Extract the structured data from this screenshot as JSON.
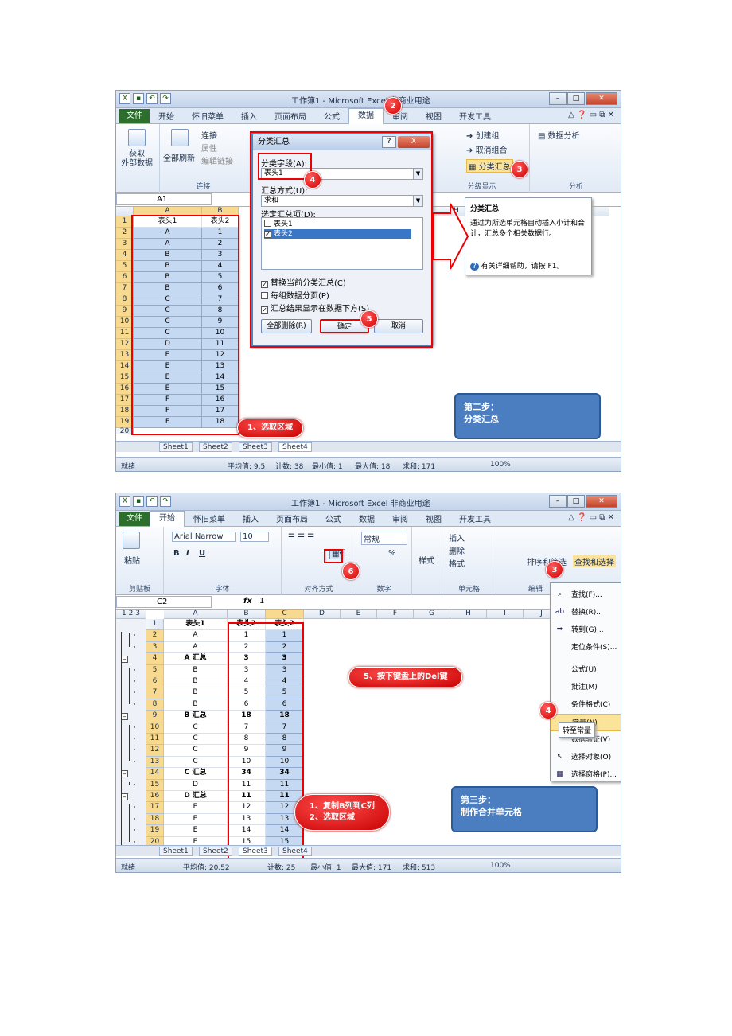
{
  "common": {
    "window_title": "工作簿1 - Microsoft Excel 非商业用途",
    "file_tab": "文件",
    "tabs": [
      "开始",
      "怀旧菜单",
      "插入",
      "页面布局",
      "公式",
      "数据",
      "审阅",
      "视图",
      "开发工具"
    ],
    "sheets": [
      "Sheet1",
      "Sheet2",
      "Sheet3",
      "Sheet4"
    ],
    "status_ready": "就绪",
    "zoom": "100%",
    "fx": "fx"
  },
  "s1": {
    "active_tab": "数据",
    "ribbon": {
      "get_external": "获取\n外部数据",
      "refresh_all": "全部刷新",
      "connections": "连接",
      "properties": "属性",
      "edit_links": "编辑链接",
      "group_connections": "连接",
      "create_group": "创建组",
      "ungroup": "取消组合",
      "subtotal": "分类汇总",
      "group_outline": "分级显示",
      "data_analysis": "数据分析",
      "group_analysis": "分析"
    },
    "name_box": "A1",
    "col_headers": [
      "A",
      "B",
      "H",
      "L"
    ],
    "rows": [
      [
        "表头1",
        "表头2"
      ],
      [
        "A",
        "1"
      ],
      [
        "A",
        "2"
      ],
      [
        "B",
        "3"
      ],
      [
        "B",
        "4"
      ],
      [
        "B",
        "5"
      ],
      [
        "B",
        "6"
      ],
      [
        "C",
        "7"
      ],
      [
        "C",
        "8"
      ],
      [
        "C",
        "9"
      ],
      [
        "C",
        "10"
      ],
      [
        "D",
        "11"
      ],
      [
        "E",
        "12"
      ],
      [
        "E",
        "13"
      ],
      [
        "E",
        "14"
      ],
      [
        "E",
        "15"
      ],
      [
        "F",
        "16"
      ],
      [
        "F",
        "17"
      ],
      [
        "F",
        "18"
      ]
    ],
    "row_last": "20",
    "dialog": {
      "title": "分类汇总",
      "help": "?",
      "close": "X",
      "field_label": "分类字段(A):",
      "field_value": "表头1",
      "func_label": "汇总方式(U):",
      "func_value": "求和",
      "items_label": "选定汇总项(D):",
      "items": [
        {
          "label": "表头1",
          "checked": false
        },
        {
          "label": "表头2",
          "checked": true
        }
      ],
      "opt_replace": "替换当前分类汇总(C)",
      "opt_pagebreak": "每组数据分页(P)",
      "opt_below": "汇总结果显示在数据下方(S)",
      "btn_remove": "全部删除(R)",
      "btn_ok": "确定",
      "btn_cancel": "取消"
    },
    "tooltip": {
      "title": "分类汇总",
      "body": "通过为所选单元格自动插入小计和合计，汇总多个相关数据行。",
      "help": "有关详细帮助，请按 F1。"
    },
    "steps": {
      "n2": "2",
      "n3": "3",
      "n4": "4",
      "n5": "5",
      "select_range": "1、选取区域"
    },
    "callout": "第二步：\n分类汇总",
    "status": {
      "avg": "平均值: 9.5",
      "count": "计数: 38",
      "min": "最小值: 1",
      "max": "最大值: 18",
      "sum": "求和: 171"
    }
  },
  "s2": {
    "active_tab": "开始",
    "ribbon": {
      "paste": "粘贴",
      "font_name": "Arial Narrow",
      "font_size": "10",
      "bold": "B",
      "italic": "I",
      "underline": "U",
      "number_format": "常规",
      "percent": "%",
      "style": "样式",
      "insert": "插入",
      "delete": "删除",
      "format": "格式",
      "sort_filter": "排序和筛选",
      "find_select": "查找和选择",
      "g_clipboard": "剪贴板",
      "g_font": "字体",
      "g_align": "对齐方式",
      "g_number": "数字",
      "g_cells": "单元格",
      "g_edit": "编辑"
    },
    "name_box": "C2",
    "formula_value": "1",
    "outline_levels": [
      "1",
      "2",
      "3"
    ],
    "col_headers": [
      "A",
      "B",
      "C",
      "D",
      "E",
      "F",
      "G",
      "H",
      "I",
      "J"
    ],
    "rows": [
      [
        "1",
        "表头1",
        "表头2",
        "表头2"
      ],
      [
        "2",
        "A",
        "1",
        "1"
      ],
      [
        "3",
        "A",
        "2",
        "2"
      ],
      [
        "4",
        "A 汇总",
        "3",
        "3"
      ],
      [
        "5",
        "B",
        "3",
        "3"
      ],
      [
        "6",
        "B",
        "4",
        "4"
      ],
      [
        "7",
        "B",
        "5",
        "5"
      ],
      [
        "8",
        "B",
        "6",
        "6"
      ],
      [
        "9",
        "B 汇总",
        "18",
        "18"
      ],
      [
        "10",
        "C",
        "7",
        "7"
      ],
      [
        "11",
        "C",
        "8",
        "8"
      ],
      [
        "12",
        "C",
        "9",
        "9"
      ],
      [
        "13",
        "C",
        "10",
        "10"
      ],
      [
        "14",
        "C 汇总",
        "34",
        "34"
      ],
      [
        "15",
        "D",
        "11",
        "11"
      ],
      [
        "16",
        "D 汇总",
        "11",
        "11"
      ],
      [
        "17",
        "E",
        "12",
        "12"
      ],
      [
        "18",
        "E",
        "13",
        "13"
      ],
      [
        "19",
        "E",
        "14",
        "14"
      ],
      [
        "20",
        "E",
        "15",
        "15"
      ]
    ],
    "menu": [
      {
        "icon": "binoculars-icon",
        "glyph": "⌕",
        "label": "查找(F)..."
      },
      {
        "icon": "replace-icon",
        "glyph": "ab",
        "label": "替换(R)..."
      },
      {
        "icon": "goto-icon",
        "glyph": "➡",
        "label": "转到(G)..."
      },
      {
        "icon": "none",
        "glyph": "",
        "label": "定位条件(S)..."
      },
      {
        "icon": "none",
        "glyph": "",
        "label": "公式(U)"
      },
      {
        "icon": "none",
        "glyph": "",
        "label": "批注(M)"
      },
      {
        "icon": "none",
        "glyph": "",
        "label": "条件格式(C)"
      },
      {
        "icon": "none",
        "glyph": "",
        "label": "常量(N)"
      },
      {
        "icon": "none",
        "glyph": "",
        "label": "数据验证(V)"
      },
      {
        "icon": "pointer-icon",
        "glyph": "↖",
        "label": "选择对象(O)"
      },
      {
        "icon": "pane-icon",
        "glyph": "▦",
        "label": "选择窗格(P)..."
      }
    ],
    "tooltip_const": "转至常量",
    "steps": {
      "n3": "3",
      "n4": "4",
      "n6": "6",
      "press_del": "5、按下键盘上的Del键",
      "copy_select": "1、复制B列到C列\n2、选取区域"
    },
    "callout": "第三步：\n制作合并单元格",
    "status": {
      "avg": "平均值: 20.52",
      "count": "计数: 25",
      "min": "最小值: 1",
      "max": "最大值: 171",
      "sum": "求和: 513"
    }
  }
}
